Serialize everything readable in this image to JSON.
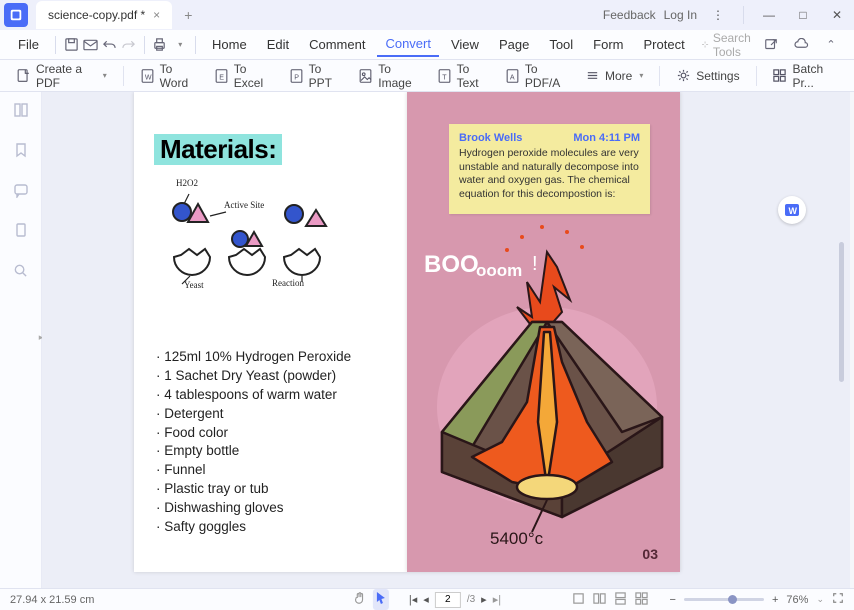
{
  "titlebar": {
    "tab_name": "science-copy.pdf *",
    "feedback": "Feedback",
    "login": "Log In"
  },
  "menubar": {
    "file": "File",
    "items": [
      "Home",
      "Edit",
      "Comment",
      "Convert",
      "View",
      "Page",
      "Tool",
      "Form",
      "Protect"
    ],
    "active_index": 3,
    "search_placeholder": "Search Tools"
  },
  "toolbar": {
    "create_pdf": "Create a PDF",
    "to_word": "To Word",
    "to_excel": "To Excel",
    "to_ppt": "To PPT",
    "to_image": "To Image",
    "to_text": "To Text",
    "to_pdfa": "To PDF/A",
    "more": "More",
    "settings": "Settings",
    "batch": "Batch Pr..."
  },
  "document": {
    "page1": {
      "title": "Materials:",
      "diagram_labels": {
        "h2o2": "H2O2",
        "active_site": "Active Site",
        "yeast": "Yeast",
        "reaction": "Reaction"
      },
      "list": [
        "125ml 10% Hydrogen Peroxide",
        "1 Sachet Dry Yeast (powder)",
        "4 tablespoons of warm water",
        "Detergent",
        "Food color",
        "Empty bottle",
        "Funnel",
        "Plastic tray or tub",
        "Dishwashing gloves",
        "Safty goggles"
      ]
    },
    "page2": {
      "sticky": {
        "author": "Brook Wells",
        "time": "Mon 4:11 PM",
        "body": "Hydrogen peroxide molecules are very unstable and naturally decompose into water and oxygen gas. The chemical equation for this decompostion is:"
      },
      "boom_text": "BOOooom!",
      "temp_label": "5400°c",
      "page_number": "03"
    }
  },
  "statusbar": {
    "dimensions": "27.94 x 21.59 cm",
    "current_page": "2",
    "total_pages": "/3",
    "zoom": "76%"
  }
}
